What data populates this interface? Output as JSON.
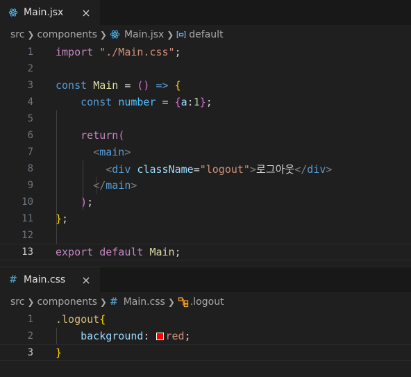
{
  "top": {
    "tab": {
      "label": "Main.jsx",
      "close": "×"
    },
    "breadcrumb": [
      "src",
      "components",
      "Main.jsx",
      "default"
    ],
    "lines": [
      {
        "n": "1"
      },
      {
        "n": "2"
      },
      {
        "n": "3"
      },
      {
        "n": "4"
      },
      {
        "n": "5"
      },
      {
        "n": "6"
      },
      {
        "n": "7"
      },
      {
        "n": "8"
      },
      {
        "n": "9"
      },
      {
        "n": "10"
      },
      {
        "n": "11"
      },
      {
        "n": "12"
      },
      {
        "n": "13"
      }
    ],
    "code": {
      "l1_import": "import",
      "l1_path": "\"./Main.css\"",
      "l1_semi": ";",
      "l3_const": "const",
      "l3_name": "Main",
      "l3_eq": " = ",
      "l3_parens": "()",
      "l3_arrow": " => ",
      "l3_brace": "{",
      "l4_const": "const",
      "l4_var": "number",
      "l4_eq": " = ",
      "l4_open": "{",
      "l4_key": "a",
      "l4_colon": ":",
      "l4_val": "1",
      "l4_close": "}",
      "l4_semi": ";",
      "l6_return": "return",
      "l6_paren": "(",
      "l7_open": "<",
      "l7_tag": "main",
      "l7_close": ">",
      "l8_open": "<",
      "l8_tag": "div",
      "l8_attr": "className",
      "l8_eq": "=",
      "l8_val": "\"logout\"",
      "l8_gt": ">",
      "l8_text": "로그아웃",
      "l8_endopen": "</",
      "l8_endtag": "div",
      "l8_endgt": ">",
      "l9_open": "</",
      "l9_tag": "main",
      "l9_close": ">",
      "l10_paren": ")",
      "l10_semi": ";",
      "l11_brace": "}",
      "l11_semi": ";",
      "l13_export": "export",
      "l13_default": "default",
      "l13_name": "Main",
      "l13_semi": ";"
    }
  },
  "bottom": {
    "tab": {
      "label": "Main.css",
      "close": "×",
      "icon": "#"
    },
    "breadcrumb": [
      "src",
      "components",
      "Main.css",
      ".logout"
    ],
    "lines": [
      {
        "n": "1"
      },
      {
        "n": "2"
      },
      {
        "n": "3"
      }
    ],
    "code": {
      "l1_selector": ".logout",
      "l1_brace": "{",
      "l2_prop": "background",
      "l2_colon": ": ",
      "l2_value": "red",
      "l2_semi": ";",
      "l3_brace": "}"
    }
  },
  "colors": {
    "swatch": "#ff0000",
    "react_icon": "#4fc1ff",
    "css_icon": "#519aba",
    "accent": "#007acc"
  },
  "icons": {
    "breadcrumb_sep": "chevron-right-icon",
    "jsx_tab": "react-icon",
    "css_tab": "hash-icon",
    "symbol_default": "symbol-variable-icon",
    "symbol_class": "symbol-class-icon"
  }
}
